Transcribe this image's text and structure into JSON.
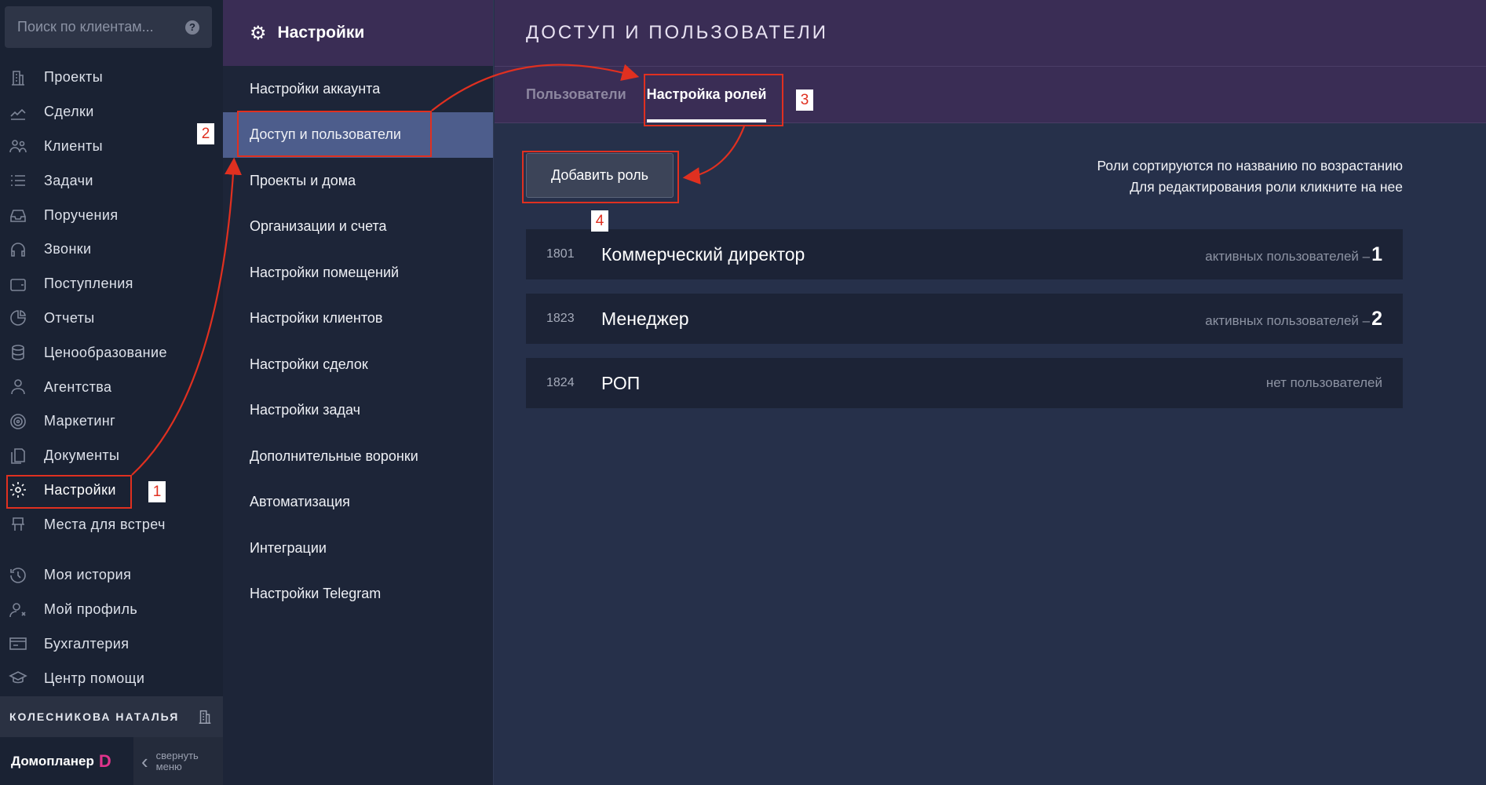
{
  "search": {
    "placeholder": "Поиск по клиентам..."
  },
  "nav": {
    "items": [
      {
        "label": "Проекты",
        "icon": "building-icon"
      },
      {
        "label": "Сделки",
        "icon": "deal-icon"
      },
      {
        "label": "Клиенты",
        "icon": "clients-icon"
      },
      {
        "label": "Задачи",
        "icon": "tasks-icon"
      },
      {
        "label": "Поручения",
        "icon": "inbox-icon"
      },
      {
        "label": "Звонки",
        "icon": "headset-icon"
      },
      {
        "label": "Поступления",
        "icon": "wallet-icon"
      },
      {
        "label": "Отчеты",
        "icon": "pie-icon"
      },
      {
        "label": "Ценообразование",
        "icon": "coins-icon"
      },
      {
        "label": "Агентства",
        "icon": "agent-icon"
      },
      {
        "label": "Маркетинг",
        "icon": "target-icon"
      },
      {
        "label": "Документы",
        "icon": "documents-icon"
      },
      {
        "label": "Настройки",
        "icon": "gear-icon",
        "active": true
      },
      {
        "label": "Места для встреч",
        "icon": "meeting-icon"
      }
    ],
    "secondary": [
      {
        "label": "Моя история",
        "icon": "history-icon"
      },
      {
        "label": "Мой профиль",
        "icon": "profile-icon"
      },
      {
        "label": "Бухгалтерия",
        "icon": "accounting-icon"
      },
      {
        "label": "Центр помощи",
        "icon": "graduation-icon"
      }
    ],
    "user_name": "КОЛЕСНИКОВА НАТАЛЬЯ",
    "brand": "Домопланер",
    "brand_letter": "D",
    "collapse_line1": "свернуть",
    "collapse_line2": "меню"
  },
  "settings": {
    "title": "Настройки",
    "items": [
      "Настройки аккаунта",
      "Доступ и пользователи",
      "Проекты и дома",
      "Организации и счета",
      "Настройки помещений",
      "Настройки клиентов",
      "Настройки сделок",
      "Настройки задач",
      "Дополнительные воронки",
      "Автоматизация",
      "Интеграции",
      "Настройки Telegram"
    ],
    "active_index": 1
  },
  "main": {
    "title": "ДОСТУП И ПОЛЬЗОВАТЕЛИ",
    "tabs": [
      "Пользователи",
      "Настройка ролей"
    ],
    "active_tab": 1,
    "add_button": "Добавить роль",
    "hint_line1": "Роли сортируются по названию по возрастанию",
    "hint_line2": "Для редактирования роли кликните на нее",
    "roles": [
      {
        "id": "1801",
        "name": "Коммерческий директор",
        "status": "активных пользователей –",
        "count": "1"
      },
      {
        "id": "1823",
        "name": "Менеджер",
        "status": "активных пользователей –",
        "count": "2"
      },
      {
        "id": "1824",
        "name": "РОП",
        "status": "нет пользователей",
        "count": ""
      }
    ]
  },
  "annotations": {
    "step1": "1",
    "step2": "2",
    "step3": "3",
    "step4": "4",
    "color": "#e03020"
  }
}
